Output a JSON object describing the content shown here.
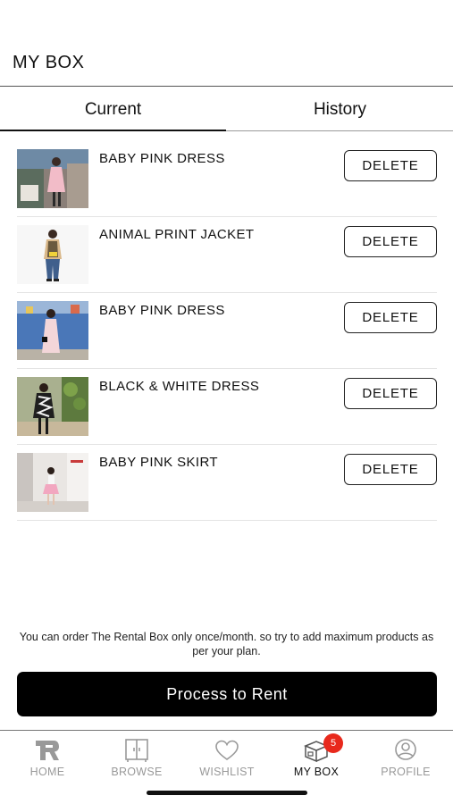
{
  "header": {
    "title": "MY BOX"
  },
  "tabs": [
    {
      "label": "Current",
      "selected": true
    },
    {
      "label": "History",
      "selected": false
    }
  ],
  "items": [
    {
      "name": "BABY PINK DRESS",
      "delete_label": "DELETE"
    },
    {
      "name": "ANIMAL PRINT JACKET",
      "delete_label": "DELETE"
    },
    {
      "name": "BABY PINK DRESS",
      "delete_label": "DELETE"
    },
    {
      "name": "BLACK & WHITE DRESS",
      "delete_label": "DELETE"
    },
    {
      "name": "BABY PINK SKIRT",
      "delete_label": "DELETE"
    }
  ],
  "note": "You can order The Rental Box only once/month. so try to add maximum products as per your plan.",
  "primary_action": {
    "label": "Process to Rent"
  },
  "bottom_nav": [
    {
      "label": "HOME",
      "icon": "logo-icon",
      "active": false
    },
    {
      "label": "BROWSE",
      "icon": "wardrobe-icon",
      "active": false
    },
    {
      "label": "WISHLIST",
      "icon": "heart-icon",
      "active": false
    },
    {
      "label": "MY BOX",
      "icon": "box-icon",
      "active": true,
      "badge": "5"
    },
    {
      "label": "PROFILE",
      "icon": "user-icon",
      "active": false
    }
  ],
  "colors": {
    "primary": "#000000",
    "badge": "#e8291c",
    "inactive": "#999999"
  }
}
